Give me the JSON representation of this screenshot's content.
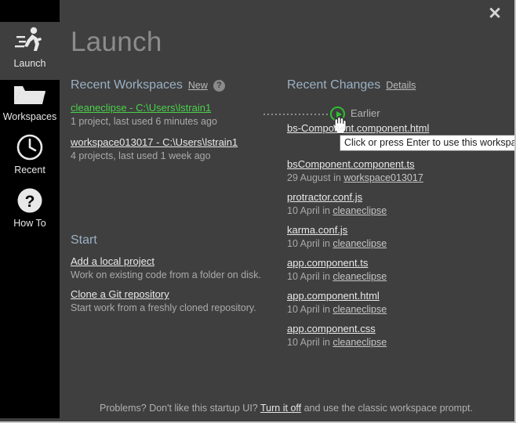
{
  "window": {
    "close_label": "✕"
  },
  "sidebar": {
    "items": [
      {
        "label": "Launch",
        "icon": "runner-icon",
        "active": true
      },
      {
        "label": "Workspaces",
        "icon": "folder-icon",
        "active": false
      },
      {
        "label": "Recent",
        "icon": "clock-icon",
        "active": false
      },
      {
        "label": "How To",
        "icon": "question-icon",
        "active": false
      }
    ]
  },
  "page": {
    "title": "Launch"
  },
  "recent_workspaces": {
    "heading": "Recent Workspaces",
    "new_label": "New",
    "help_label": "?",
    "items": [
      {
        "name": "cleaneclipse - C:\\Users\\lstrain1",
        "meta": "1 project, last used 6 minutes ago",
        "highlighted": true
      },
      {
        "name": "workspace013017 - C:\\Users\\lstrain1",
        "meta": "4 projects, last used 1 week ago",
        "highlighted": false
      }
    ]
  },
  "recent_changes": {
    "heading": "Recent Changes",
    "details_label": "Details",
    "group_label": "Earlier",
    "tooltip": "Click or press Enter to use this workspace",
    "items": [
      {
        "name": "bs-Component.component.html",
        "date": "",
        "in_label": "",
        "workspace": ""
      },
      {
        "name": "bsComponent.component.ts",
        "date": "29 August",
        "in_label": "in",
        "workspace": "workspace013017"
      },
      {
        "name": "protractor.conf.js",
        "date": "10 April",
        "in_label": "in",
        "workspace": "cleaneclipse"
      },
      {
        "name": "karma.conf.js",
        "date": "10 April",
        "in_label": "in",
        "workspace": "cleaneclipse"
      },
      {
        "name": "app.component.ts",
        "date": "10 April",
        "in_label": "in",
        "workspace": "cleaneclipse"
      },
      {
        "name": "app.component.html",
        "date": "10 April",
        "in_label": "in",
        "workspace": "cleaneclipse"
      },
      {
        "name": "app.component.css",
        "date": "10 April",
        "in_label": "in",
        "workspace": "cleaneclipse"
      }
    ]
  },
  "start": {
    "heading": "Start",
    "items": [
      {
        "link": "Add a local project",
        "desc": "Work on existing code from a folder on disk."
      },
      {
        "link": "Clone a Git repository",
        "desc": "Start work from a freshly cloned repository."
      }
    ]
  },
  "footer": {
    "prefix": "Problems? Don't like this startup UI?",
    "link": "Turn it off",
    "suffix": "and use the classic workspace prompt."
  },
  "colors": {
    "background": "#3f3f3f",
    "sidebar": "#000000",
    "accent_green": "#2fbf2f",
    "heading_blue": "#9bb0c4",
    "title_gray": "#8c8c8c"
  }
}
